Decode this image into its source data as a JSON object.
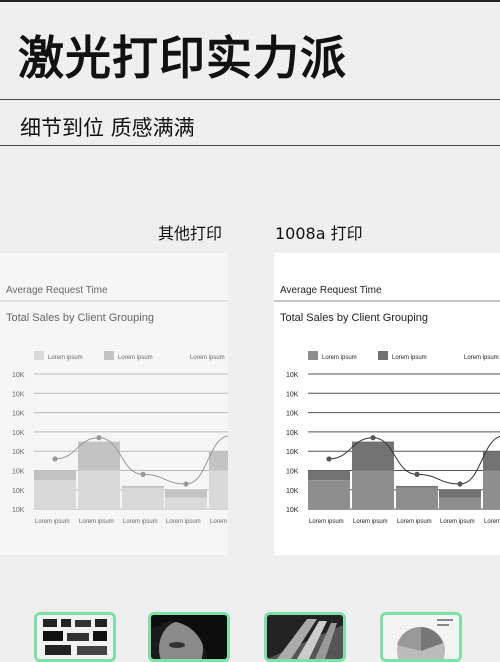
{
  "header": {
    "title": "激光打印实力派",
    "subtitle": "细节到位 质感满满"
  },
  "comparison": [
    {
      "label": "其他打印",
      "variant": "blurred",
      "report_title": "Average Request Time",
      "chart_title": "Total Sales by Client Grouping",
      "legend": [
        "Lorem ipsum",
        "Lorem ipsum",
        "Lorem ipsum"
      ]
    },
    {
      "label": "1008a 打印",
      "variant": "sharp",
      "report_title": "Average Request Time",
      "chart_title": "Total Sales by Client Grouping",
      "legend": [
        "Lorem ipsum",
        "Lorem ipsum",
        "Lorem ipsum"
      ]
    }
  ],
  "chart_data": {
    "type": "bar",
    "y_tick_labels": [
      "10K",
      "10K",
      "10K",
      "10K",
      "10K",
      "10K",
      "10K",
      "10K"
    ],
    "categories": [
      "Lorem ipsum",
      "Lorem ipsum",
      "Lorem ipsum",
      "Lorem ipsum",
      "Lorem ipsum"
    ],
    "series": [
      {
        "values": [
          2,
          3.5,
          1.2,
          1,
          3
        ]
      },
      {
        "values": [
          1.5,
          2,
          1.1,
          0.6,
          2
        ]
      }
    ],
    "line_values": [
      2.6,
      3.7,
      1.8,
      1.3,
      3.8
    ],
    "visible_categories": 5,
    "grid": true,
    "legend_position": "top"
  },
  "thumbnails": [
    {
      "name": "text-sample"
    },
    {
      "name": "portrait-sample"
    },
    {
      "name": "architecture-sample"
    },
    {
      "name": "chart-sample"
    }
  ],
  "colors": {
    "accent": "#7fe0a5",
    "bar_dark": "#6f6f6f",
    "bar_light": "#8c8c8c"
  }
}
